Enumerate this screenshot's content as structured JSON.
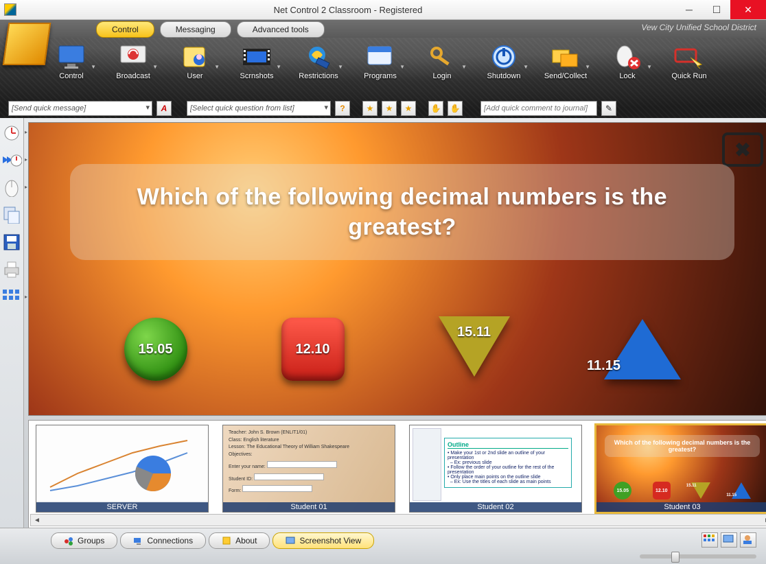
{
  "window": {
    "title": "Net Control 2 Classroom - Registered"
  },
  "org": "Vew City Unified School District",
  "tabs": {
    "control": "Control",
    "messaging": "Messaging",
    "advanced": "Advanced tools"
  },
  "toolbar": [
    {
      "id": "control",
      "label": "Control"
    },
    {
      "id": "broadcast",
      "label": "Broadcast"
    },
    {
      "id": "user",
      "label": "User"
    },
    {
      "id": "scrnshots",
      "label": "Scrnshots"
    },
    {
      "id": "restrictions",
      "label": "Restrictions"
    },
    {
      "id": "programs",
      "label": "Programs"
    },
    {
      "id": "login",
      "label": "Login"
    },
    {
      "id": "shutdown",
      "label": "Shutdown"
    },
    {
      "id": "sendcollect",
      "label": "Send/Collect"
    },
    {
      "id": "lock",
      "label": "Lock"
    },
    {
      "id": "quickrun",
      "label": "Quick Run"
    }
  ],
  "quickbar": {
    "message_placeholder": "[Send quick message]",
    "question_placeholder": "[Select quick question from list]",
    "journal_placeholder": "[Add quick comment to journal]"
  },
  "slide": {
    "question": "Which of the following decimal numbers is the greatest?",
    "answers": {
      "a": "15.05",
      "b": "12.10",
      "c": "15.11",
      "d": "11.15"
    }
  },
  "thumbs": [
    {
      "id": "server",
      "label": "SERVER"
    },
    {
      "id": "s1",
      "label": "Student 01"
    },
    {
      "id": "s2",
      "label": "Student 02"
    },
    {
      "id": "s3",
      "label": "Student 03"
    }
  ],
  "bottom_tabs": {
    "groups": "Groups",
    "connections": "Connections",
    "about": "About",
    "screenshot": "Screenshot View"
  }
}
